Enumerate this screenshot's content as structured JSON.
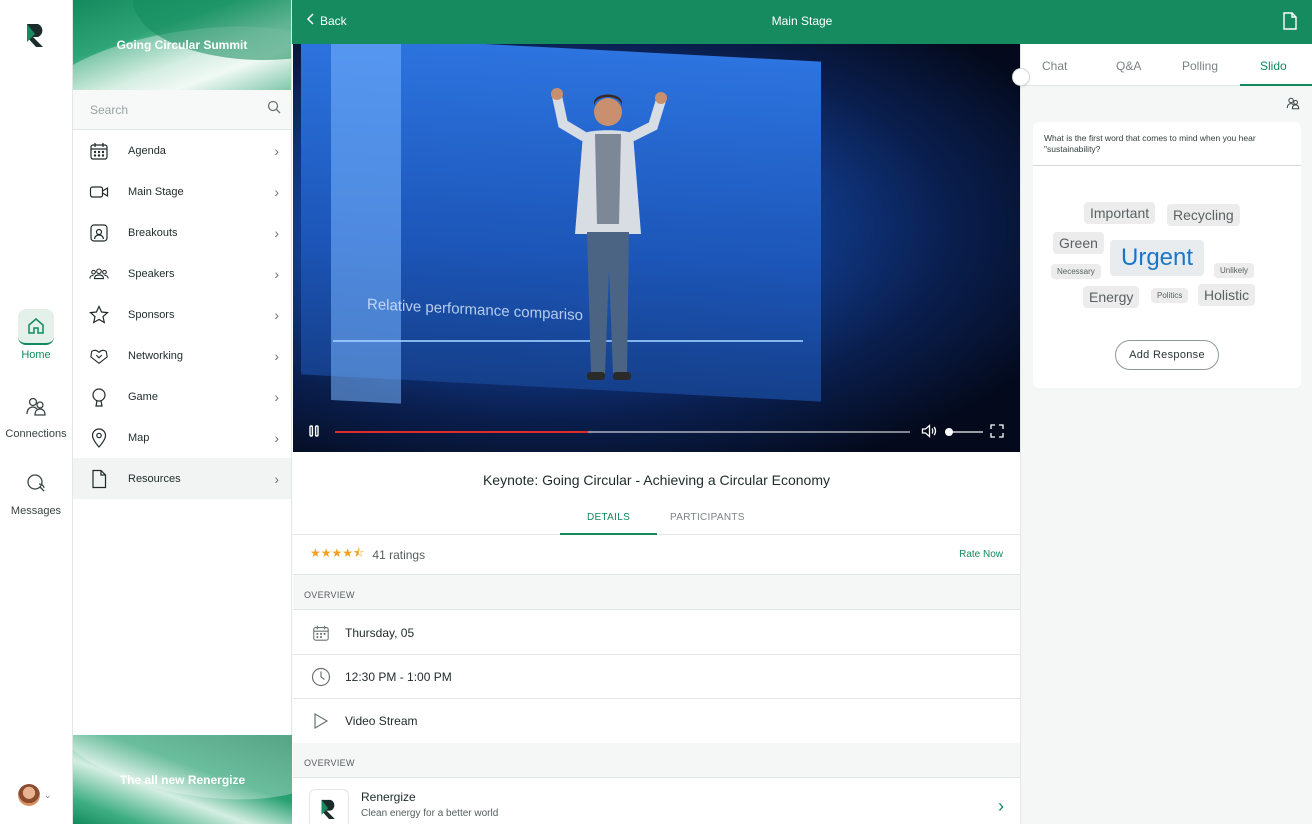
{
  "rail": {
    "items": [
      {
        "label": "Home",
        "icon": "home-icon",
        "active": true
      },
      {
        "label": "Connections",
        "icon": "connections-icon",
        "active": false
      },
      {
        "label": "Messages",
        "icon": "messages-icon",
        "active": false
      }
    ]
  },
  "sidebar": {
    "banner_title": "Going Circular Summit",
    "search_placeholder": "Search",
    "items": [
      {
        "label": "Agenda",
        "icon": "calendar-icon"
      },
      {
        "label": "Main Stage",
        "icon": "video-camera-icon"
      },
      {
        "label": "Breakouts",
        "icon": "breakouts-icon"
      },
      {
        "label": "Speakers",
        "icon": "speakers-icon"
      },
      {
        "label": "Sponsors",
        "icon": "star-icon"
      },
      {
        "label": "Networking",
        "icon": "networking-icon"
      },
      {
        "label": "Game",
        "icon": "trophy-icon"
      },
      {
        "label": "Map",
        "icon": "map-pin-icon"
      },
      {
        "label": "Resources",
        "icon": "document-icon",
        "selected": true
      }
    ],
    "bottom_banner": "The all new Renergize"
  },
  "header": {
    "back_label": "Back",
    "title": "Main Stage"
  },
  "video": {
    "screen_text": "Relative performance compariso",
    "progress_fraction": 0.44,
    "volume_fraction": 0.0
  },
  "session": {
    "title": "Keynote: Going Circular - Achieving a Circular Economy",
    "tabs": [
      "DETAILS",
      "PARTICIPANTS"
    ],
    "active_tab": "DETAILS",
    "rating_value": 4.5,
    "stars": "★★★★⯪",
    "rating_count": "41 ratings",
    "rate_now": "Rate Now",
    "overview_label": "OVERVIEW",
    "date": "Thursday, 05",
    "time": "12:30 PM - 1:00 PM",
    "format": "Video Stream",
    "overview_label_2": "OVERVIEW",
    "sponsor": {
      "name": "Renergize",
      "tagline": "Clean energy for a better world"
    }
  },
  "panel": {
    "tabs": [
      "Chat",
      "Q&A",
      "Polling",
      "Slido"
    ],
    "active_tab": "Slido",
    "question": "What is the first word that comes to mind when you hear \"sustainability?",
    "words": [
      "Important",
      "Recycling",
      "Green",
      "Urgent",
      "Necessary",
      "Unlikely",
      "Energy",
      "Politics",
      "Holistic"
    ],
    "add_response": "Add Response"
  },
  "colors": {
    "brand_green": "#168b5f",
    "accent_green": "#138a5d",
    "progress_red": "#e02b2b",
    "star_orange": "#f2a01d",
    "word_blue": "#1b76c8"
  }
}
